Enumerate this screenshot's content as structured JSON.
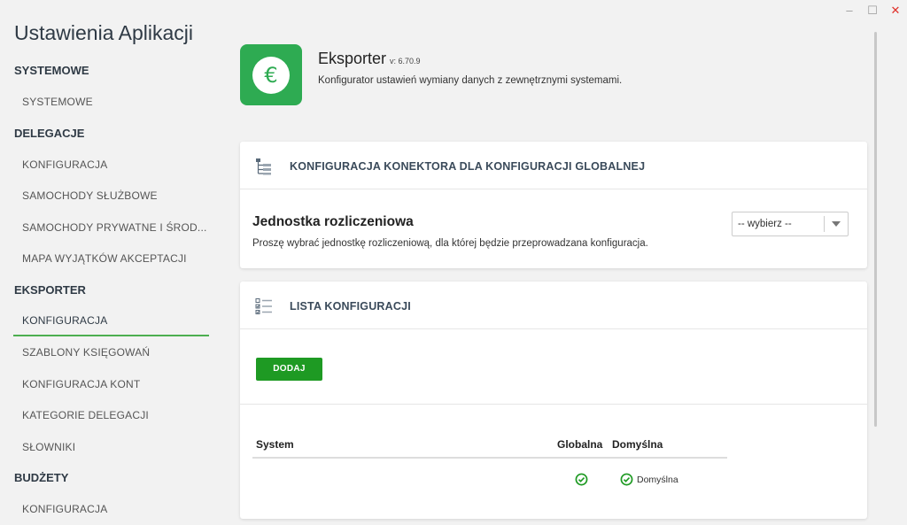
{
  "window": {
    "minimize": "–",
    "maximize": "☐",
    "close": "✕"
  },
  "sidebar": {
    "title": "Ustawienia Aplikacji",
    "groups": [
      {
        "label": "SYSTEMOWE",
        "items": [
          "SYSTEMOWE"
        ]
      },
      {
        "label": "DELEGACJE",
        "items": [
          "KONFIGURACJA",
          "SAMOCHODY SŁUŻBOWE",
          "SAMOCHODY PRYWATNE I ŚROD...",
          "MAPA WYJĄTKÓW AKCEPTACJI"
        ]
      },
      {
        "label": "EKSPORTER",
        "items": [
          "KONFIGURACJA",
          "SZABLONY KSIĘGOWAŃ",
          "KONFIGURACJA KONT",
          "KATEGORIE DELEGACJI",
          "SŁOWNIKI"
        ]
      },
      {
        "label": "BUDŻETY",
        "items": [
          "KONFIGURACJA"
        ]
      }
    ],
    "active": "EKSPORTER / KONFIGURACJA"
  },
  "app": {
    "icon_symbol": "€",
    "name": "Eksporter",
    "version": "v: 6.70.9",
    "description": "Konfigurator ustawień wymiany danych z zewnętrznymi systemami."
  },
  "connector_card": {
    "icon": "hierarchy-icon",
    "title": "KONFIGURACJA KONEKTORA DLA KONFIGURACJI GLOBALNEJ",
    "field_title": "Jednostka rozliczeniowa",
    "field_desc": "Proszę wybrać jednostkę rozliczeniową, dla której będzie przeprowadzana konfiguracja.",
    "select_value": "-- wybierz --"
  },
  "list_card": {
    "icon": "checklist-icon",
    "title": "LISTA KONFIGURACJI",
    "add_button": "DODAJ",
    "columns": {
      "system": "System",
      "global": "Globalna",
      "default": "Domyślna"
    },
    "rows": [
      {
        "system": "",
        "global": true,
        "default": true,
        "default_label": "Domyślna"
      }
    ]
  },
  "colors": {
    "accent": "#2eab52",
    "button": "#1e9a23",
    "active_underline": "#4caf50",
    "close": "#e0302a"
  }
}
